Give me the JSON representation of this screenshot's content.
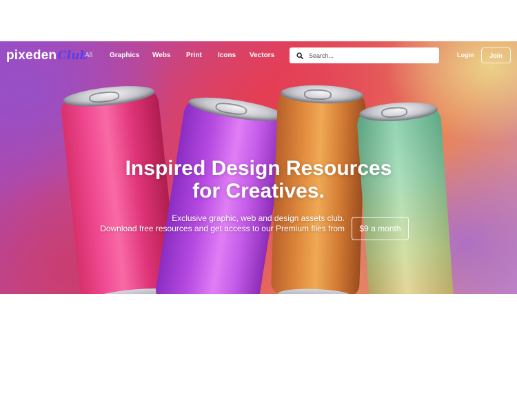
{
  "logo": {
    "main": "pixeden",
    "club": "Club"
  },
  "nav": {
    "items": [
      {
        "label": "All"
      },
      {
        "label": "Graphics"
      },
      {
        "label": "Webs"
      },
      {
        "label": "Print"
      },
      {
        "label": "Icons"
      },
      {
        "label": "Vectors"
      }
    ]
  },
  "search": {
    "placeholder": "Search..."
  },
  "auth": {
    "login": "Login",
    "join": "Join"
  },
  "hero": {
    "title_line1": "Inspired Design Resources",
    "title_line2": "for Creatives.",
    "sub_line1": "Exclusive graphic, web and design assets club.",
    "sub_line2": "Download free resources and get access to our Premium files from",
    "price_button": "$9 a month"
  },
  "colors": {
    "logo_club": "#5a3ee8",
    "text": "#ffffff"
  }
}
